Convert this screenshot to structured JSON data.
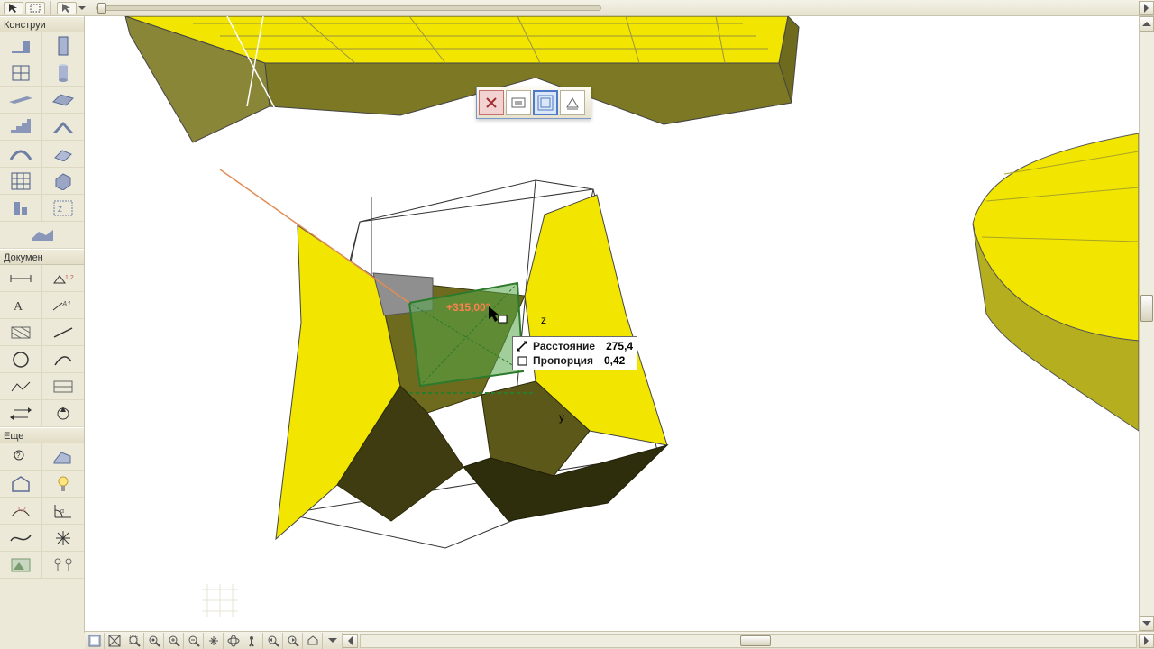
{
  "top": {},
  "toolbox": {
    "section1": "Конструи",
    "section2": "Докумен",
    "section3": "Еще"
  },
  "tracker": {
    "row1_label": "Расстояние",
    "row1_value": "275,4",
    "row2_label": "Пропорция",
    "row2_value": "0,42"
  },
  "dim_label": "+315,00°",
  "axis_z": "z",
  "axis_y": "y",
  "colors": {
    "brand_yellow": "#f2e500",
    "dark_yellow": "#6e6a1e",
    "olive": "#8a8638",
    "selection_green": "#3fae3f",
    "guide_orange": "#e28c55"
  }
}
